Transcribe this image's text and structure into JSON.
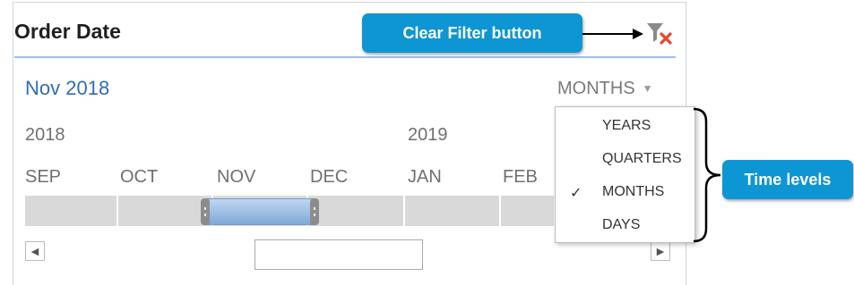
{
  "timeline": {
    "title": "Order Date",
    "selection_label": "Nov 2018",
    "time_level": "MONTHS",
    "years": [
      "2018",
      "2019"
    ],
    "months": [
      "SEP",
      "OCT",
      "NOV",
      "DEC",
      "JAN",
      "FEB"
    ],
    "selected_month": "NOV"
  },
  "dropdown": {
    "options": [
      "YEARS",
      "QUARTERS",
      "MONTHS",
      "DAYS"
    ],
    "checked": "MONTHS",
    "check_glyph": "✓"
  },
  "callouts": {
    "clear_filter": "Clear Filter button",
    "time_levels": "Time levels"
  },
  "icons": {
    "clear_filter": "clear-filter-icon",
    "scroll_left": "◀",
    "scroll_right": "▶",
    "caret": "▼"
  },
  "colors": {
    "callout": "#0e95d4",
    "selection_text": "#2f6db3",
    "selected_period": "#9fc3ea",
    "clear_x": "#e8452c"
  }
}
